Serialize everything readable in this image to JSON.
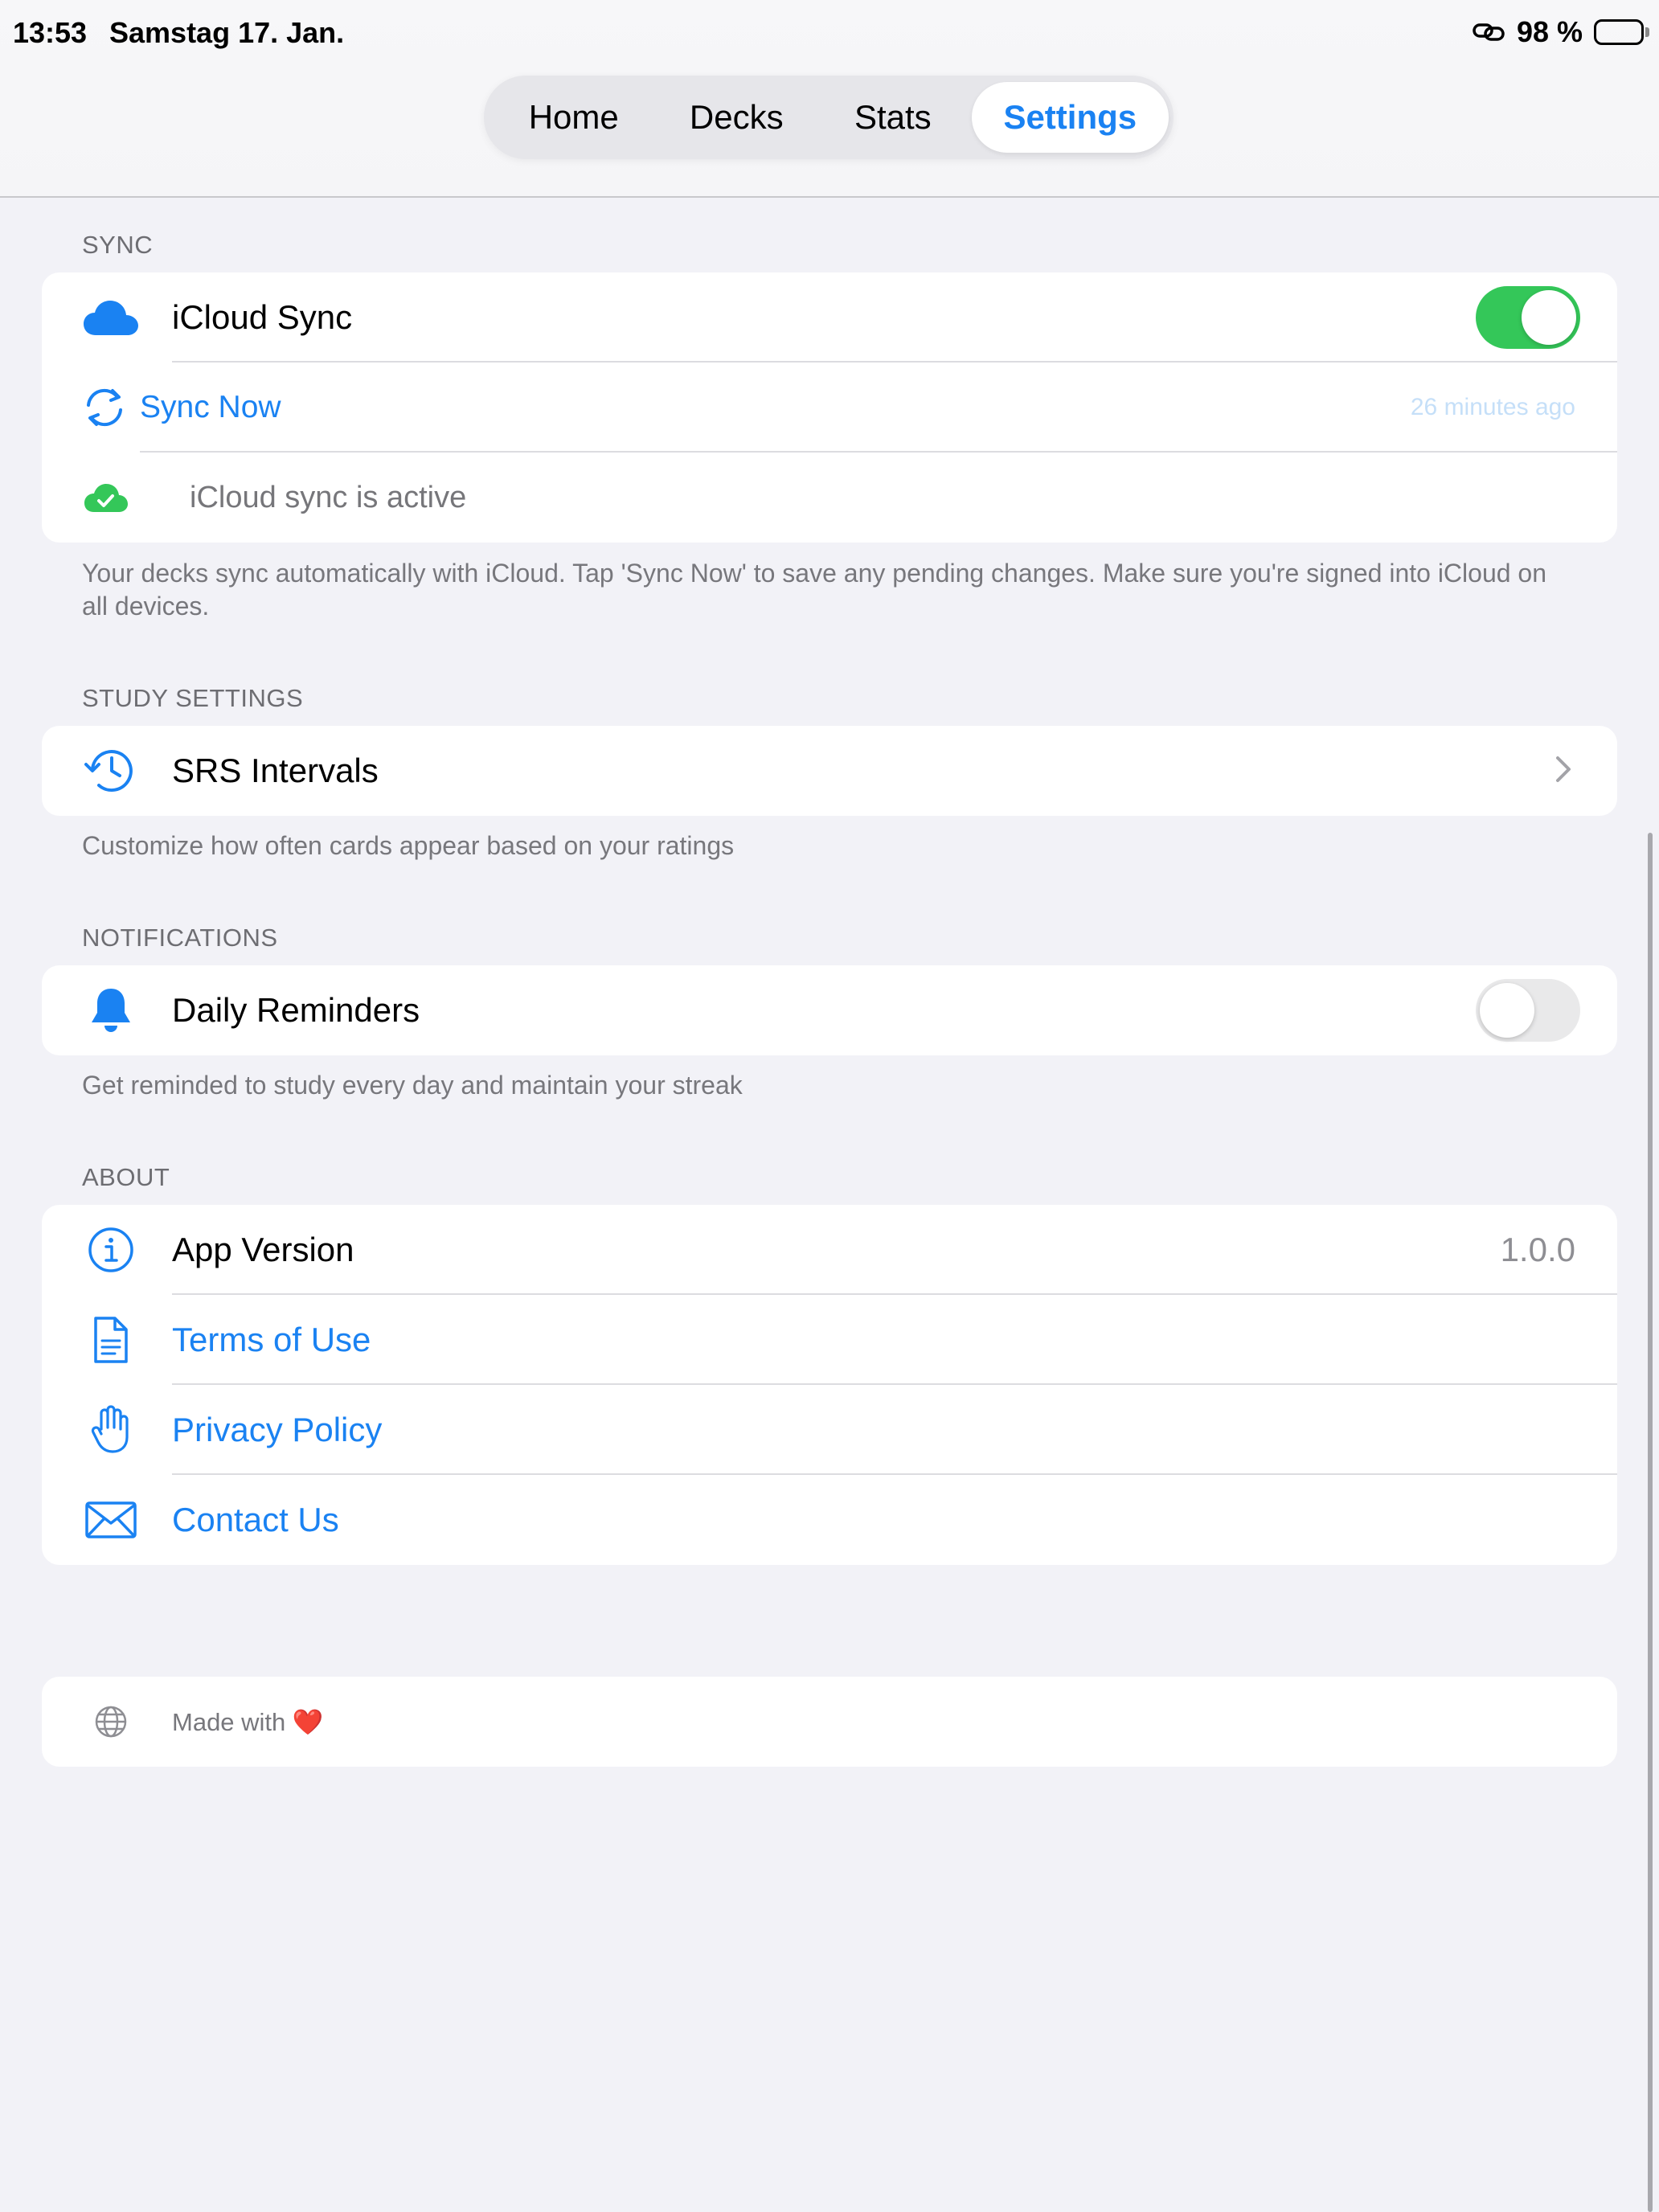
{
  "status_bar": {
    "time": "13:53",
    "date": "Samstag 17. Jan.",
    "battery": "98 %"
  },
  "tabs": [
    {
      "label": "Home"
    },
    {
      "label": "Decks"
    },
    {
      "label": "Stats"
    },
    {
      "label": "Settings",
      "selected": true
    }
  ],
  "sync": {
    "header": "SYNC",
    "icloud_sync_label": "iCloud Sync",
    "icloud_sync_on": true,
    "sync_now_label": "Sync Now",
    "last_synced": "26 minutes ago",
    "status_text": "iCloud sync is active",
    "footer": "Your decks sync automatically with iCloud. Tap 'Sync Now' to save any pending changes. Make sure you're signed into iCloud on all devices."
  },
  "study": {
    "header": "STUDY SETTINGS",
    "srs_label": "SRS Intervals",
    "footer": "Customize how often cards appear based on your ratings"
  },
  "notifications": {
    "header": "NOTIFICATIONS",
    "daily_reminders_label": "Daily Reminders",
    "daily_reminders_on": false,
    "footer": "Get reminded to study every day and maintain your streak"
  },
  "about": {
    "header": "ABOUT",
    "app_version_label": "App Version",
    "app_version": "1.0.0",
    "terms_label": "Terms of Use",
    "privacy_label": "Privacy Policy",
    "contact_label": "Contact Us"
  },
  "credit": {
    "made_with": "Made with",
    "heart": "❤️"
  },
  "colors": {
    "accent": "#1a82f2",
    "toggle_on": "#34c759",
    "background": "#f2f2f7"
  }
}
